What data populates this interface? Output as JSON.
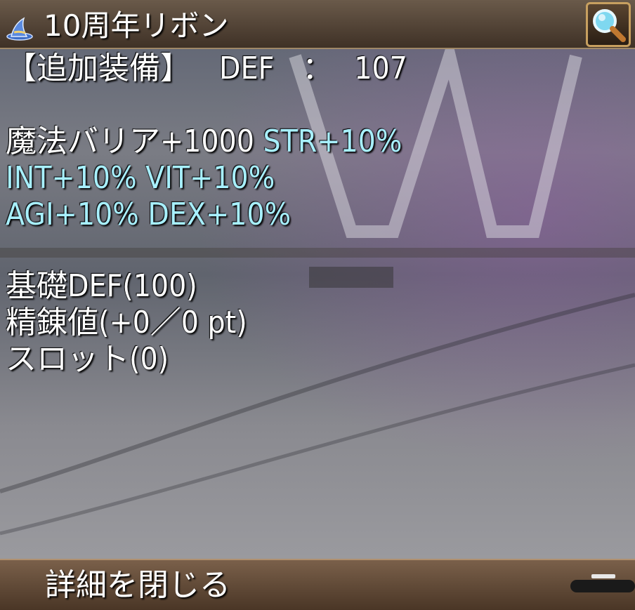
{
  "item": {
    "name": "10周年リボン",
    "icon": "wizard-hat-icon"
  },
  "header_line": {
    "slot_label": "【追加装備】",
    "stat_label": "DEF",
    "separator": "：",
    "stat_value": "107"
  },
  "effects": {
    "row1_white": "魔法バリア+1000",
    "row1_cyan": "STR+10%",
    "row2": "INT+10% VIT+10%",
    "row3": "AGI+10% DEX+10%"
  },
  "base_stats": {
    "base_def": "基礎DEF(100)",
    "refine": "精錬値(+0／0 pt)",
    "slots": "スロット(0)"
  },
  "footer": {
    "close_label": "詳細を閉じる"
  },
  "colors": {
    "effect_text": "#a8f0ff",
    "title_bar": "#3f3126",
    "button_border": "#c8a060"
  }
}
